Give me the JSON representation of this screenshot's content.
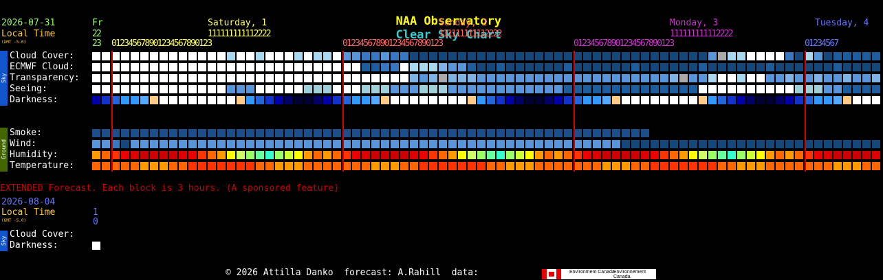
{
  "title": {
    "part1": "NAA Observatory",
    "part2": "Clear Sky Chart"
  },
  "header": {
    "date": "2026-07-31",
    "local_time": "Local Time",
    "gmt": "(GMT -5.0)",
    "days": [
      {
        "label": "Fr",
        "color": "#99ff66"
      },
      {
        "label": "Saturday, 1",
        "color": "#ffff66"
      },
      {
        "label": "Sunday, 2",
        "color": "#ff6666"
      },
      {
        "label": "Monday, 3",
        "color": "#cc33cc"
      },
      {
        "label": "Tuesday, 4",
        "color": "#6677ff"
      }
    ],
    "tens": [
      {
        "text": "2 2",
        "color": "#99ff66"
      },
      {
        "text": "1 1 1 1 1 1 1 1 1 1 1 2 2 2 2",
        "color": "#ffff66"
      },
      {
        "text": "1 1 1 1 1 1 1 1 1 1 1 2 2 2 2",
        "color": "#ff6666"
      },
      {
        "text": "1 1 1 1 1 1 1 1 1 1 1 2 2 2 2",
        "color": "#cc33cc"
      }
    ],
    "ones": [
      {
        "text": "2 3",
        "color": "#99ff66"
      },
      {
        "text": "0 1 2 3 4 5 6 7 8 9 0 1 2 3 4 5 6 7 8 9 0 1 2 3",
        "color": "#ffff66"
      },
      {
        "text": "0 1 2 3 4 5 6 7 8 9 0 1 2 3 4 5 6 7 8 9 0 1 2 3",
        "color": "#ff6666"
      },
      {
        "text": "0 1 2 3 4 5 6 7 8 9 0 1 2 3 4 5 6 7 8 9 0 1 2 3",
        "color": "#cc33cc"
      },
      {
        "text": "0 1 2 3 4 5 6 7",
        "color": "#6677ff"
      }
    ]
  },
  "sky_label": "Sky",
  "ground_label": "Ground",
  "sky_rows": [
    {
      "label": "Cloud Cover:",
      "pattern": "W",
      "name": "cloud-cover"
    },
    {
      "label": "ECMWF Cloud:",
      "pattern": "E",
      "name": "ecmwf-cloud"
    },
    {
      "label": "Transparency:",
      "pattern": "T",
      "name": "transparency"
    },
    {
      "label": "Seeing:",
      "pattern": "S",
      "name": "seeing"
    },
    {
      "label": "Darkness:",
      "pattern": "D",
      "name": "darkness"
    }
  ],
  "ground_rows": [
    {
      "label": "Smoke:",
      "pattern": "K",
      "name": "smoke"
    },
    {
      "label": "Wind:",
      "pattern": "N",
      "name": "wind"
    },
    {
      "label": "Humidity:",
      "pattern": "H",
      "name": "humidity"
    },
    {
      "label": "Temperature:",
      "pattern": "P",
      "name": "temperature"
    }
  ],
  "extended": {
    "notice": "EXTENDED Forecast. Each block is 3 hours. (A sponsored feature)",
    "date": "2026-08-04",
    "local_time": "Local Time",
    "gmt": "(GMT -5.0)",
    "tens": "1",
    "ones": "0",
    "rows": [
      {
        "label": "Cloud Cover:"
      },
      {
        "label": "Darkness:"
      }
    ]
  },
  "footer": {
    "text": "© 2026 Attilla Danko  forecast: A.Rahill  data:"
  },
  "logo": {
    "en": "Environment Canada",
    "fr": "Environnement Canada"
  },
  "colors": {
    "title_yellow": "#ffff00",
    "title_cyan": "#33cccc",
    "notice_red": "#cc0000",
    "midnight_line": "#dd0000",
    "sky_bar": "#1155cc",
    "ground_bar": "#446600"
  }
}
